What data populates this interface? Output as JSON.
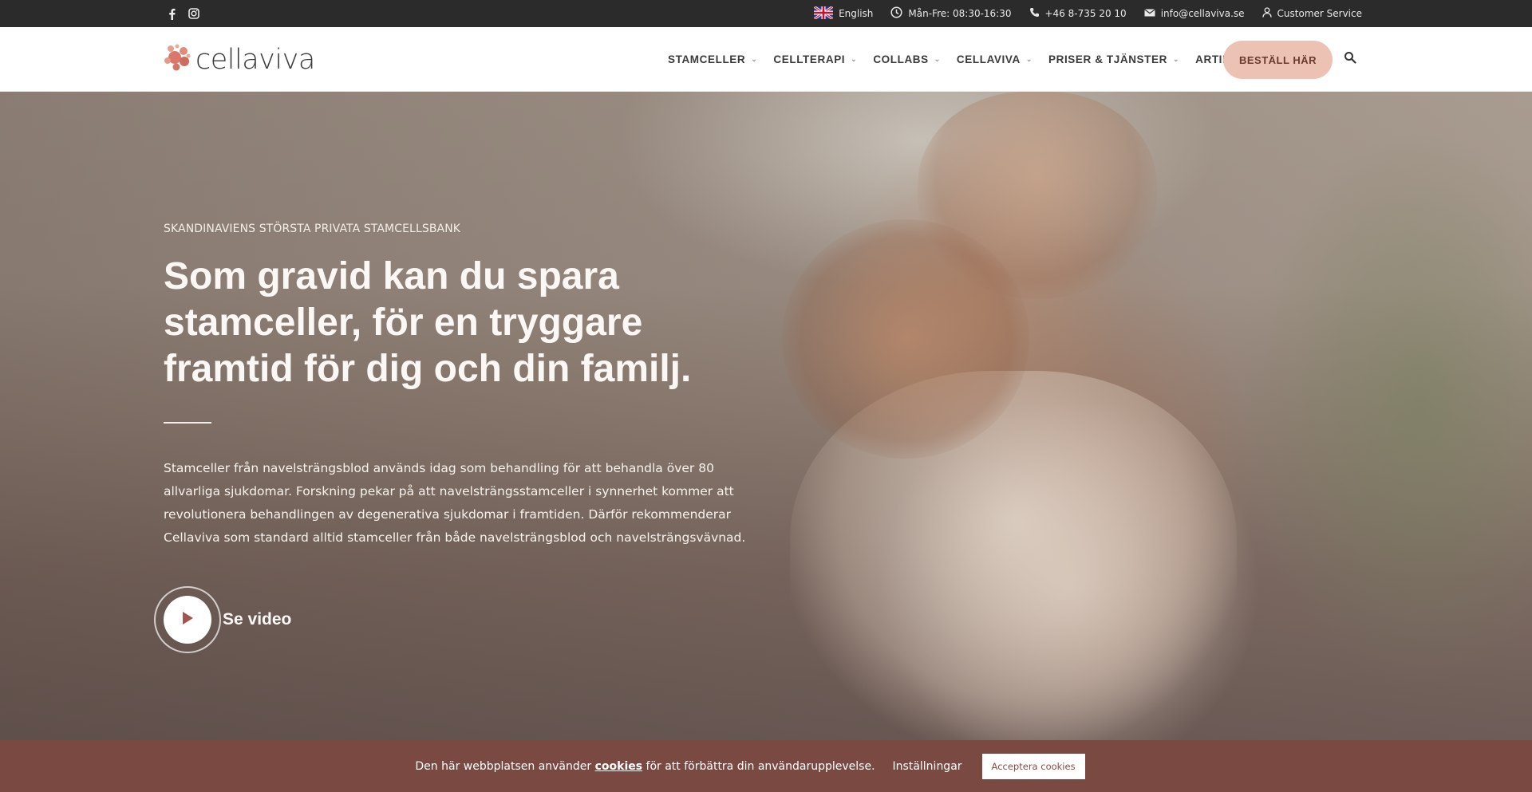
{
  "topbar": {
    "language": "English",
    "hours": "Mån-Fre: 08:30-16:30",
    "phone": "+46 8-735 20 10",
    "email": "info@cellaviva.se",
    "customer_service": "Customer Service"
  },
  "header": {
    "logo_text": "cellaviva",
    "nav": [
      {
        "label": "STAMCELLER"
      },
      {
        "label": "CELLTERAPI"
      },
      {
        "label": "COLLABS"
      },
      {
        "label": "CELLAVIVA"
      },
      {
        "label": "PRISER & TJÄNSTER"
      },
      {
        "label": "ARTIKLAR"
      }
    ],
    "cta_label": "BESTÄLL HÄR"
  },
  "hero": {
    "eyebrow": "SKANDINAVIENS STÖRSTA PRIVATA STAMCELLSBANK",
    "headline": "Som gravid kan du spara stamceller, för en tryggare framtid för dig och din familj.",
    "lead": "Stamceller från navelsträngsblod används idag som behandling för att behandla över 80 allvarliga sjukdomar. Forskning pekar på att navelsträngsstamceller i synnerhet kommer att revolutionera behandlingen av degenerativa sjukdomar i framtiden. Därför rekommenderar Cellaviva som standard alltid stamceller från både navelsträngsblod och navelsträngsvävnad.",
    "video_label": "Se video"
  },
  "cookie_bar": {
    "text_before": "Den här webbplatsen använder ",
    "link": "cookies",
    "text_after": " för att förbättra din användarupplevelse.",
    "settings": "Inställningar",
    "accept": "Acceptera cookies"
  },
  "colors": {
    "topbar_bg": "#2b2b2b",
    "cta_bg": "#ecc2b5",
    "cookie_bg": "#7a4a42",
    "logo_dots": "#d9786a"
  }
}
